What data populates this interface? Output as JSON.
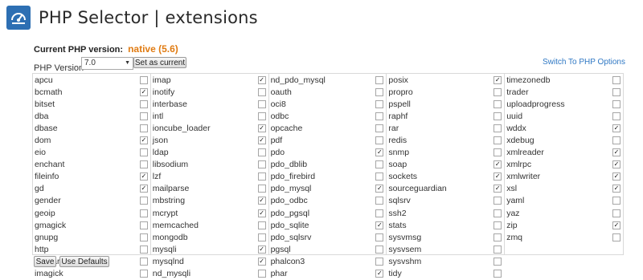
{
  "header": {
    "title": "PHP Selector | extensions"
  },
  "current_version": {
    "label": "Current PHP version:",
    "value": "native (5.6)"
  },
  "php_version": {
    "label": "PHP Version",
    "selected": "7.0"
  },
  "buttons": {
    "set_current": "Set as current",
    "save": "Save",
    "use_defaults": "Use Defaults"
  },
  "switch_link": "Switch To PHP Options",
  "columns": [
    [
      {
        "name": "apcu",
        "checked": false
      },
      {
        "name": "bcmath",
        "checked": true
      },
      {
        "name": "bitset",
        "checked": false
      },
      {
        "name": "dba",
        "checked": false
      },
      {
        "name": "dbase",
        "checked": false
      },
      {
        "name": "dom",
        "checked": true
      },
      {
        "name": "eio",
        "checked": false
      },
      {
        "name": "enchant",
        "checked": false
      },
      {
        "name": "fileinfo",
        "checked": true
      },
      {
        "name": "gd",
        "checked": true
      },
      {
        "name": "gender",
        "checked": false
      },
      {
        "name": "geoip",
        "checked": false
      },
      {
        "name": "gmagick",
        "checked": false
      },
      {
        "name": "gnupg",
        "checked": false
      },
      {
        "name": "http",
        "checked": false
      },
      {
        "name": "igbinary",
        "checked": false
      },
      {
        "name": "imagick",
        "checked": false
      }
    ],
    [
      {
        "name": "imap",
        "checked": true
      },
      {
        "name": "inotify",
        "checked": false
      },
      {
        "name": "interbase",
        "checked": false
      },
      {
        "name": "intl",
        "checked": false
      },
      {
        "name": "ioncube_loader",
        "checked": true
      },
      {
        "name": "json",
        "checked": true
      },
      {
        "name": "ldap",
        "checked": false
      },
      {
        "name": "libsodium",
        "checked": false
      },
      {
        "name": "lzf",
        "checked": false
      },
      {
        "name": "mailparse",
        "checked": false
      },
      {
        "name": "mbstring",
        "checked": true
      },
      {
        "name": "mcrypt",
        "checked": true
      },
      {
        "name": "memcached",
        "checked": false
      },
      {
        "name": "mongodb",
        "checked": false
      },
      {
        "name": "mysqli",
        "checked": true
      },
      {
        "name": "mysqlnd",
        "checked": true
      },
      {
        "name": "nd_mysqli",
        "checked": false
      }
    ],
    [
      {
        "name": "nd_pdo_mysql",
        "checked": false
      },
      {
        "name": "oauth",
        "checked": false
      },
      {
        "name": "oci8",
        "checked": false
      },
      {
        "name": "odbc",
        "checked": false
      },
      {
        "name": "opcache",
        "checked": false
      },
      {
        "name": "pdf",
        "checked": false
      },
      {
        "name": "pdo",
        "checked": true
      },
      {
        "name": "pdo_dblib",
        "checked": false
      },
      {
        "name": "pdo_firebird",
        "checked": false
      },
      {
        "name": "pdo_mysql",
        "checked": true
      },
      {
        "name": "pdo_odbc",
        "checked": false
      },
      {
        "name": "pdo_pgsql",
        "checked": false
      },
      {
        "name": "pdo_sqlite",
        "checked": true
      },
      {
        "name": "pdo_sqlsrv",
        "checked": false
      },
      {
        "name": "pgsql",
        "checked": false
      },
      {
        "name": "phalcon3",
        "checked": false
      },
      {
        "name": "phar",
        "checked": true
      }
    ],
    [
      {
        "name": "posix",
        "checked": true
      },
      {
        "name": "propro",
        "checked": false
      },
      {
        "name": "pspell",
        "checked": false
      },
      {
        "name": "raphf",
        "checked": false
      },
      {
        "name": "rar",
        "checked": false
      },
      {
        "name": "redis",
        "checked": false
      },
      {
        "name": "snmp",
        "checked": false
      },
      {
        "name": "soap",
        "checked": true
      },
      {
        "name": "sockets",
        "checked": true
      },
      {
        "name": "sourceguardian",
        "checked": true
      },
      {
        "name": "sqlsrv",
        "checked": false
      },
      {
        "name": "ssh2",
        "checked": false
      },
      {
        "name": "stats",
        "checked": false
      },
      {
        "name": "sysvmsg",
        "checked": false
      },
      {
        "name": "sysvsem",
        "checked": false
      },
      {
        "name": "sysvshm",
        "checked": false
      },
      {
        "name": "tidy",
        "checked": false
      }
    ],
    [
      {
        "name": "timezonedb",
        "checked": false
      },
      {
        "name": "trader",
        "checked": false
      },
      {
        "name": "uploadprogress",
        "checked": false
      },
      {
        "name": "uuid",
        "checked": false
      },
      {
        "name": "wddx",
        "checked": true
      },
      {
        "name": "xdebug",
        "checked": false
      },
      {
        "name": "xmlreader",
        "checked": true
      },
      {
        "name": "xmlrpc",
        "checked": true
      },
      {
        "name": "xmlwriter",
        "checked": true
      },
      {
        "name": "xsl",
        "checked": true
      },
      {
        "name": "yaml",
        "checked": false
      },
      {
        "name": "yaz",
        "checked": false
      },
      {
        "name": "zip",
        "checked": true
      },
      {
        "name": "zmq",
        "checked": false
      }
    ]
  ]
}
